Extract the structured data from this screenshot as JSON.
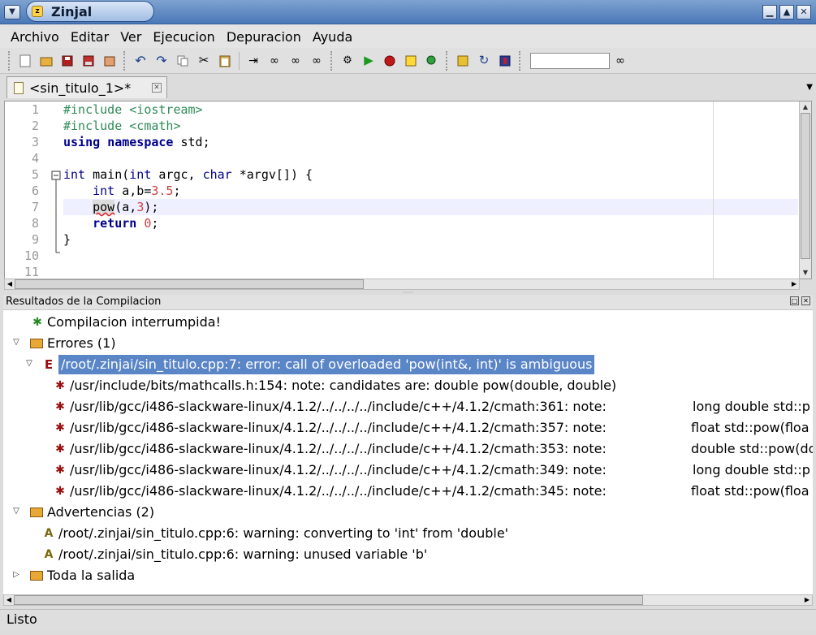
{
  "window": {
    "title": "Zinjal"
  },
  "menu": [
    "Archivo",
    "Editar",
    "Ver",
    "Ejecucion",
    "Depuracion",
    "Ayuda"
  ],
  "toolbar": {
    "group1": [
      "new-file-icon",
      "open-file-icon",
      "save-icon",
      "save-as-icon",
      "close-file-icon"
    ],
    "group2": [
      "undo-icon",
      "redo-icon",
      "copy-icon",
      "cut-icon",
      "paste-icon",
      "indent-icon",
      "find-icon",
      "find-prev-icon",
      "find-next-icon"
    ],
    "group3": [
      "compile-icon",
      "run-icon",
      "stop-icon",
      "debug-icon",
      "inspect-icon"
    ],
    "group4": [
      "options-icon",
      "refresh-icon",
      "help-icon"
    ],
    "search_value": ""
  },
  "tab": {
    "label": "<sin_titulo_1>*"
  },
  "editor": {
    "line_numbers": [
      "1",
      "2",
      "3",
      "4",
      "5",
      "6",
      "7",
      "8",
      "9",
      "10",
      "11"
    ],
    "lines": [
      {
        "segments": [
          {
            "t": "#include <iostream>",
            "c": "pp"
          }
        ]
      },
      {
        "segments": [
          {
            "t": "#include <cmath>",
            "c": "pp"
          }
        ]
      },
      {
        "segments": [
          {
            "t": "using",
            "c": "kw"
          },
          {
            "t": " ",
            "c": ""
          },
          {
            "t": "namespace",
            "c": "kw"
          },
          {
            "t": " std;",
            "c": ""
          }
        ]
      },
      {
        "segments": [
          {
            "t": "",
            "c": ""
          }
        ]
      },
      {
        "segments": [
          {
            "t": "int",
            "c": "ty"
          },
          {
            "t": " main(",
            "c": ""
          },
          {
            "t": "int",
            "c": "ty"
          },
          {
            "t": " argc, ",
            "c": ""
          },
          {
            "t": "char",
            "c": "ty"
          },
          {
            "t": " *argv[]) {",
            "c": ""
          }
        ]
      },
      {
        "segments": [
          {
            "t": "    ",
            "c": ""
          },
          {
            "t": "int",
            "c": "ty"
          },
          {
            "t": " a,b=",
            "c": ""
          },
          {
            "t": "3.5",
            "c": "num"
          },
          {
            "t": ";",
            "c": ""
          }
        ]
      },
      {
        "segments": [
          {
            "t": "    ",
            "c": ""
          },
          {
            "t": "pow",
            "c": "err-ul"
          },
          {
            "t": "(a,",
            "c": ""
          },
          {
            "t": "3",
            "c": "num"
          },
          {
            "t": ");",
            "c": ""
          }
        ]
      },
      {
        "segments": [
          {
            "t": "    ",
            "c": ""
          },
          {
            "t": "return",
            "c": "kw"
          },
          {
            "t": " ",
            "c": ""
          },
          {
            "t": "0",
            "c": "num"
          },
          {
            "t": ";",
            "c": ""
          }
        ]
      },
      {
        "segments": [
          {
            "t": "}",
            "c": ""
          }
        ]
      },
      {
        "segments": [
          {
            "t": "",
            "c": ""
          }
        ]
      },
      {
        "segments": [
          {
            "t": "",
            "c": ""
          }
        ]
      }
    ]
  },
  "results": {
    "header": "Resultados de la Compilacion",
    "interrupted": "Compilacion interrumpida!",
    "errors_label": "Errores (1)",
    "error_main": "/root/.zinjai/sin_titulo.cpp:7: error: call of overloaded 'pow(int&, int)' is ambiguous",
    "notes": [
      {
        "text": "/usr/include/bits/mathcalls.h:154: note: candidates are: double pow(double, double)",
        "right": ""
      },
      {
        "text": "/usr/lib/gcc/i486-slackware-linux/4.1.2/../../../../include/c++/4.1.2/cmath:361: note:",
        "right": "long double std::p"
      },
      {
        "text": "/usr/lib/gcc/i486-slackware-linux/4.1.2/../../../../include/c++/4.1.2/cmath:357: note:",
        "right": "float std::pow(floa"
      },
      {
        "text": "/usr/lib/gcc/i486-slackware-linux/4.1.2/../../../../include/c++/4.1.2/cmath:353: note:",
        "right": "double std::pow(do"
      },
      {
        "text": "/usr/lib/gcc/i486-slackware-linux/4.1.2/../../../../include/c++/4.1.2/cmath:349: note:",
        "right": "long double std::p"
      },
      {
        "text": "/usr/lib/gcc/i486-slackware-linux/4.1.2/../../../../include/c++/4.1.2/cmath:345: note:",
        "right": "float std::pow(floa"
      }
    ],
    "warnings_label": "Advertencias (2)",
    "warnings": [
      "/root/.zinjai/sin_titulo.cpp:6: warning: converting to 'int' from 'double'",
      "/root/.zinjai/sin_titulo.cpp:6: warning: unused variable 'b'"
    ],
    "all_output_label": "Toda la salida"
  },
  "status": "Listo"
}
